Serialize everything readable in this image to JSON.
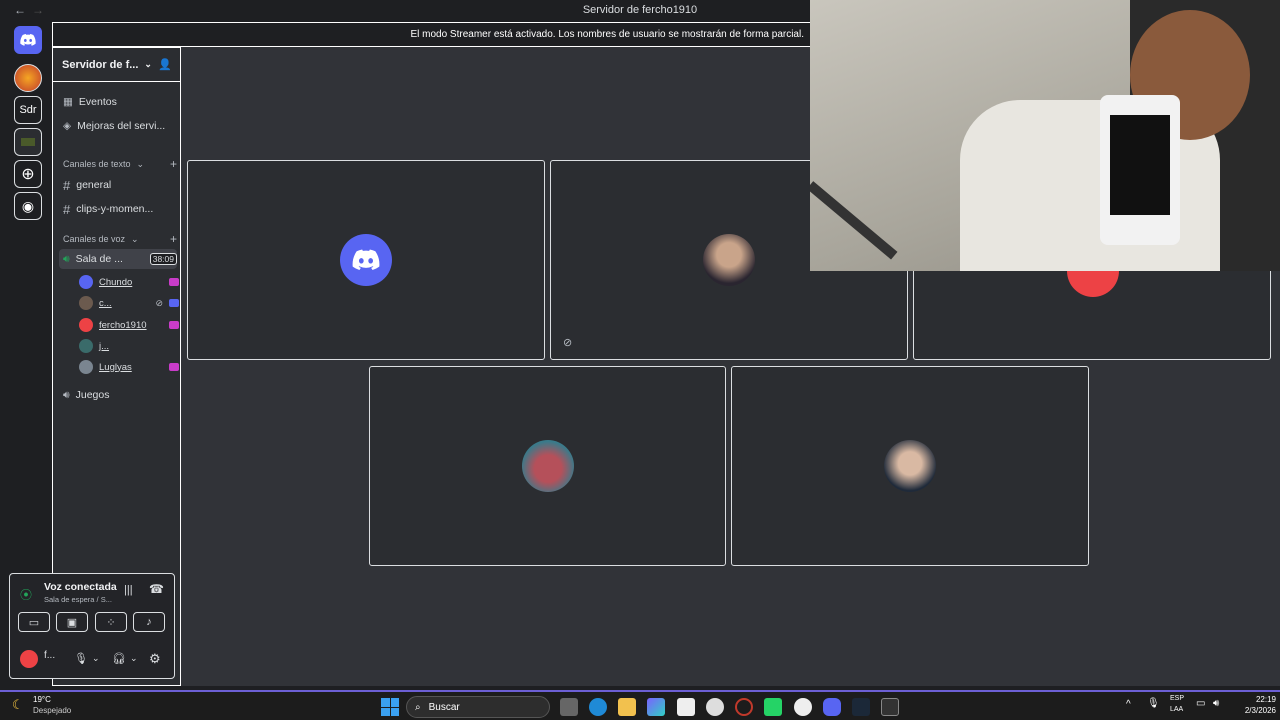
{
  "titlebar": {
    "back": "←",
    "forward": "→",
    "title": "Servidor de fercho1910"
  },
  "banner": {
    "text": "El modo Streamer está activado. Los nombres de usuario se mostrarán de forma parcial."
  },
  "rail": {
    "sdr_label": "Sdr"
  },
  "server": {
    "name": "Servidor de f..."
  },
  "sidebar": {
    "events": "Eventos",
    "boosts": "Mejoras del servi...",
    "text_category": "Canales de texto",
    "text_channels": [
      "general",
      "clips-y-momen..."
    ],
    "voice_category": "Canales de voz",
    "voice_channel_active": "Sala de ...",
    "voice_timer": "38:09",
    "voice_users": [
      "Chundo",
      "c...",
      "fercho1910",
      "j...",
      "Luglyas"
    ],
    "voice_channel_2": "Juegos"
  },
  "voice_panel": {
    "status": "Voz conectada",
    "subtitle": "Sala de espera / S..."
  },
  "user_panel": {
    "name": "f..."
  },
  "taskbar": {
    "weather_temp": "19°C",
    "weather_desc": "Despejado",
    "search_label": "Buscar",
    "lang_top": "ESP",
    "lang_bottom": "LAA",
    "time": "22:19",
    "date": "2/3/2026"
  },
  "colors": {
    "discord_blurple": "#5865f2",
    "accent_red": "#ed4245",
    "live_pink": "#c93cc9"
  }
}
